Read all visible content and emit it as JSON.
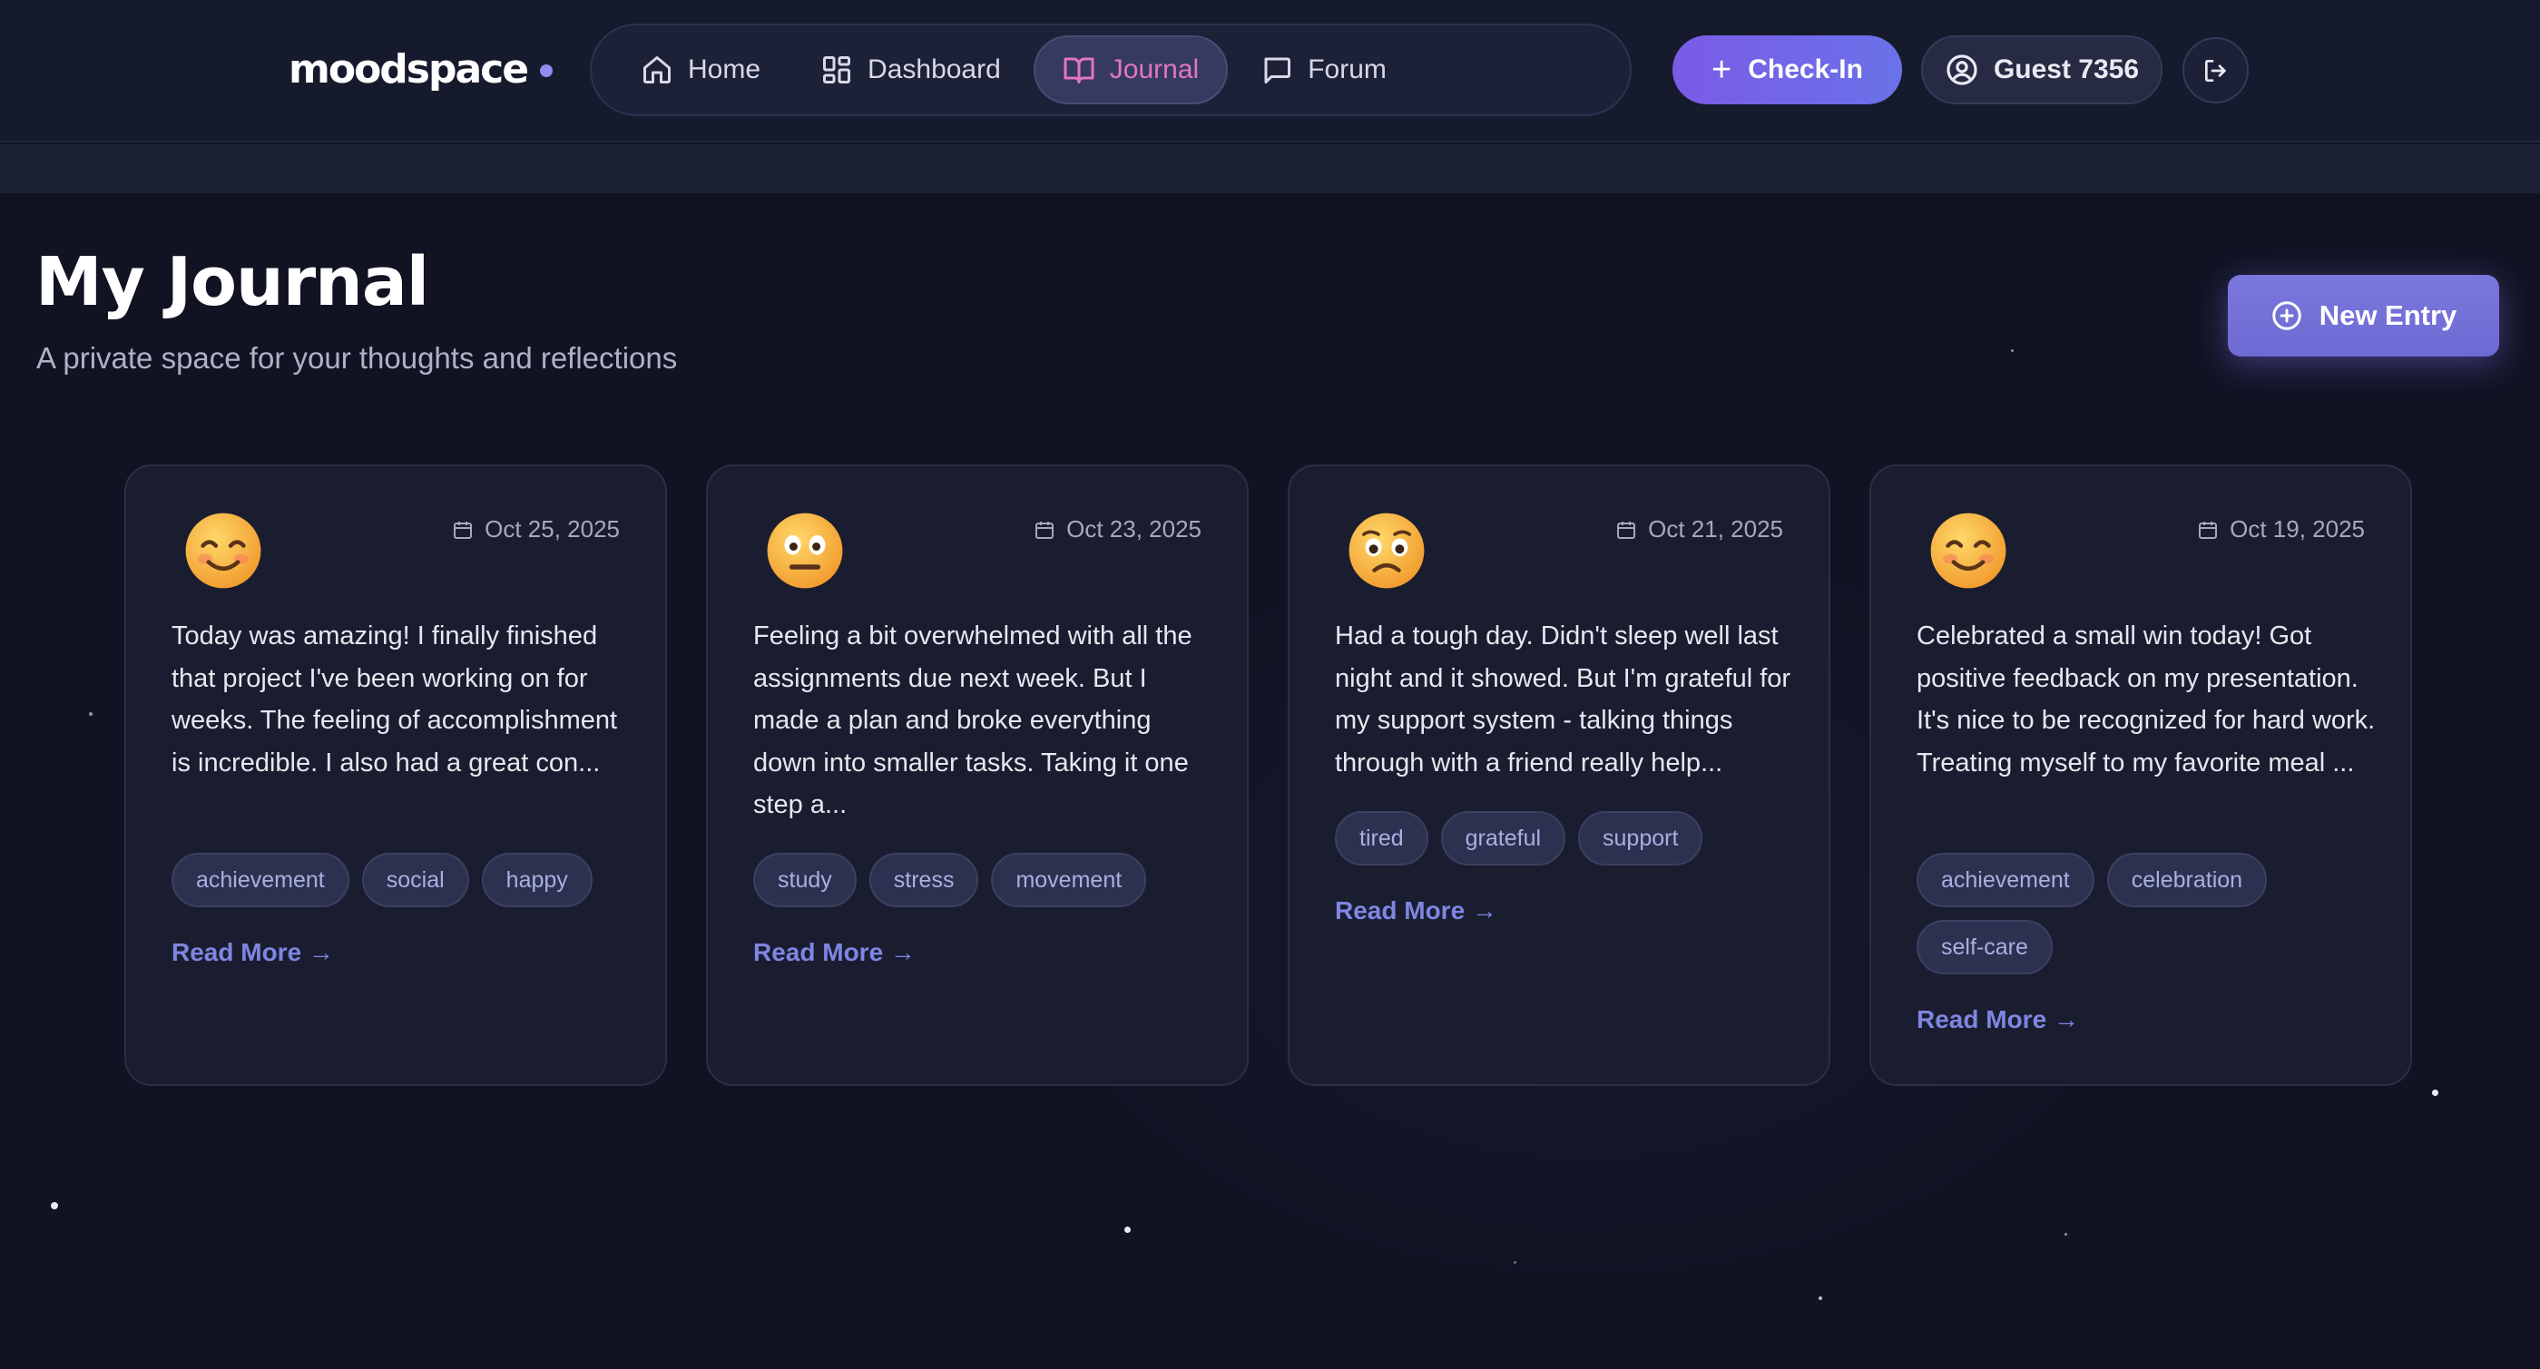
{
  "brand": {
    "name": "moodspace"
  },
  "nav": {
    "items": [
      {
        "label": "Home",
        "icon": "home-icon",
        "active": false
      },
      {
        "label": "Dashboard",
        "icon": "dashboard-icon",
        "active": false
      },
      {
        "label": "Journal",
        "icon": "book-icon",
        "active": true
      },
      {
        "label": "Forum",
        "icon": "message-icon",
        "active": false
      }
    ]
  },
  "header": {
    "checkin_label": "Check-In",
    "guest_label": "Guest 7356"
  },
  "page": {
    "title": "My Journal",
    "subtitle": "A private space for your thoughts and reflections",
    "new_entry_label": "New Entry"
  },
  "entries": [
    {
      "mood": "smiling-face",
      "date": "Oct 25, 2025",
      "text": "Today was amazing! I finally finished that project I've been working on for weeks. The feeling of accomplishment is incredible. I also had a great con...",
      "tags": [
        "achievement",
        "social",
        "happy"
      ],
      "read_more": "Read More →"
    },
    {
      "mood": "neutral-face",
      "date": "Oct 23, 2025",
      "text": "Feeling a bit overwhelmed with all the assignments due next week. But I made a plan and broke everything down into smaller tasks. Taking it one step a...",
      "tags": [
        "study",
        "stress",
        "movement"
      ],
      "read_more": "Read More →"
    },
    {
      "mood": "worried-face",
      "date": "Oct 21, 2025",
      "text": "Had a tough day. Didn't sleep well last night and it showed. But I'm grateful for my support system - talking things through with a friend really help...",
      "tags": [
        "tired",
        "grateful",
        "support"
      ],
      "read_more": "Read More →"
    },
    {
      "mood": "smiling-face",
      "date": "Oct 19, 2025",
      "text": "Celebrated a small win today! Got positive feedback on my presentation. It's nice to be recognized for hard work. Treating myself to my favorite meal ...",
      "tags": [
        "achievement",
        "celebration",
        "self-care"
      ],
      "read_more": "Read More →"
    }
  ],
  "colors": {
    "background": "#111323",
    "accent": "#7a78dd",
    "active_nav": "#e275c8",
    "link": "#7e86e2"
  }
}
